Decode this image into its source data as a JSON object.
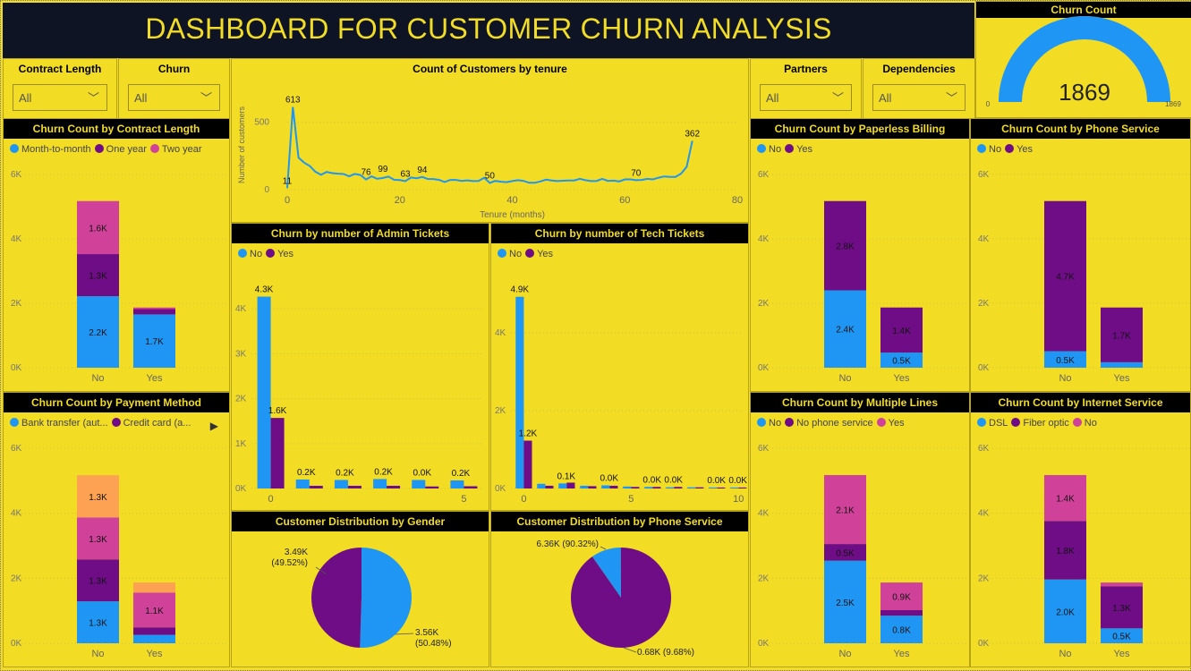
{
  "header": {
    "title": "DASHBOARD FOR CUSTOMER CHURN ANALYSIS"
  },
  "colors": {
    "bg": "#f2dc24",
    "blue": "#1f96f3",
    "purple": "#6e0d86",
    "pink": "#d04299",
    "orange": "#fca252"
  },
  "slicers": {
    "contract": {
      "title": "Contract Length",
      "value": "All"
    },
    "churn": {
      "title": "Churn",
      "value": "All"
    },
    "partners": {
      "title": "Partners",
      "value": "All"
    },
    "dependencies": {
      "title": "Dependencies",
      "value": "All"
    }
  },
  "gauge": {
    "title": "Churn Count",
    "value": "1869",
    "min": "0",
    "max": "1869",
    "fraction": 1.0
  },
  "tenure_chart": {
    "title": "Count of Customers by tenure",
    "chart_data": {
      "type": "line",
      "xlabel": "Tenure (months)",
      "ylabel": "Number of customers",
      "xticks": [
        "0",
        "20",
        "40",
        "60",
        "80"
      ],
      "yticks": [
        "0",
        "500"
      ],
      "xlim": [
        0,
        80
      ],
      "ylim": [
        0,
        650
      ],
      "x": [
        0,
        1,
        2,
        3,
        4,
        5,
        6,
        7,
        8,
        9,
        10,
        11,
        12,
        13,
        14,
        15,
        16,
        17,
        18,
        19,
        20,
        21,
        22,
        23,
        24,
        25,
        26,
        27,
        28,
        29,
        30,
        31,
        32,
        33,
        34,
        35,
        36,
        37,
        38,
        39,
        40,
        41,
        42,
        43,
        44,
        45,
        46,
        47,
        48,
        49,
        50,
        51,
        52,
        53,
        54,
        55,
        56,
        57,
        58,
        59,
        60,
        61,
        62,
        63,
        64,
        65,
        65,
        66,
        67,
        68,
        69,
        70,
        71,
        72
      ],
      "y": [
        11,
        613,
        238,
        200,
        176,
        133,
        110,
        131,
        123,
        119,
        116,
        99,
        117,
        109,
        76,
        99,
        80,
        87,
        97,
        73,
        71,
        63,
        90,
        85,
        94,
        79,
        79,
        72,
        57,
        72,
        72,
        65,
        69,
        64,
        65,
        88,
        50,
        65,
        59,
        56,
        64,
        70,
        65,
        51,
        51,
        61,
        74,
        68,
        64,
        66,
        68,
        68,
        80,
        70,
        64,
        65,
        80,
        65,
        67,
        61,
        76,
        76,
        70,
        72,
        80,
        76,
        76,
        89,
        98,
        95,
        95,
        119,
        170,
        362
      ],
      "labels": [
        {
          "x": 0,
          "y": 11,
          "text": "11"
        },
        {
          "x": 1,
          "y": 613,
          "text": "613"
        },
        {
          "x": 14,
          "y": 76,
          "text": "76"
        },
        {
          "x": 17,
          "y": 99,
          "text": "99"
        },
        {
          "x": 21,
          "y": 63,
          "text": "63"
        },
        {
          "x": 24,
          "y": 94,
          "text": "94"
        },
        {
          "x": 36,
          "y": 50,
          "text": "50"
        },
        {
          "x": 62,
          "y": 70,
          "text": "70"
        },
        {
          "x": 72,
          "y": 362,
          "text": "362"
        }
      ]
    }
  },
  "charts": {
    "contract": {
      "title": "Churn Count by Contract Length",
      "legend": [
        {
          "label": "Month-to-month",
          "color": "#1f96f3"
        },
        {
          "label": "One year",
          "color": "#6e0d86"
        },
        {
          "label": "Two year",
          "color": "#d04299"
        }
      ],
      "chart_data": {
        "type": "bar",
        "stacked": true,
        "categories": [
          "No",
          "Yes"
        ],
        "yticks": [
          "0K",
          "2K",
          "4K",
          "6K"
        ],
        "ylim": [
          0,
          6000
        ],
        "series": [
          {
            "name": "Month-to-month",
            "color": "#1f96f3",
            "values": [
              2220,
              1655
            ],
            "labels": [
              "2.2K",
              "1.7K"
            ]
          },
          {
            "name": "One year",
            "color": "#6e0d86",
            "values": [
              1307,
              166
            ],
            "labels": [
              "1.3K",
              ""
            ]
          },
          {
            "name": "Two year",
            "color": "#d04299",
            "values": [
              1647,
              48
            ],
            "labels": [
              "1.6K",
              ""
            ]
          }
        ]
      }
    },
    "payment": {
      "title": "Churn Count by Payment Method",
      "legend": [
        {
          "label": "Bank transfer (aut...",
          "color": "#1f96f3"
        },
        {
          "label": "Credit card (a...",
          "color": "#6e0d86"
        }
      ],
      "chart_data": {
        "type": "bar",
        "stacked": true,
        "categories": [
          "No",
          "Yes"
        ],
        "yticks": [
          "0K",
          "2K",
          "4K",
          "6K"
        ],
        "ylim": [
          0,
          6000
        ],
        "series": [
          {
            "name": "Bank transfer (aut...",
            "color": "#1f96f3",
            "values": [
              1290,
              260
            ],
            "labels": [
              "1.3K",
              ""
            ]
          },
          {
            "name": "Credit card (a...",
            "color": "#6e0d86",
            "values": [
              1290,
              230
            ],
            "labels": [
              "1.3K",
              ""
            ]
          },
          {
            "color": "#d04299",
            "values": [
              1290,
              1070
            ],
            "labels": [
              "1.3K",
              "1.1K"
            ]
          },
          {
            "color": "#fca252",
            "values": [
              1300,
              310
            ],
            "labels": [
              "1.3K",
              ""
            ]
          }
        ]
      }
    },
    "admin": {
      "title": "Churn by number of Admin Tickets",
      "legend": [
        {
          "label": "No",
          "color": "#1f96f3"
        },
        {
          "label": "Yes",
          "color": "#6e0d86"
        }
      ],
      "chart_data": {
        "type": "bar",
        "grouped": true,
        "xmin": -0.5,
        "xmax": 5.5,
        "xticks": [
          {
            "v": 0,
            "t": "0"
          },
          {
            "v": 5,
            "t": "5"
          }
        ],
        "yticks": [
          "0K",
          "1K",
          "2K",
          "3K",
          "4K"
        ],
        "ylim": [
          0,
          4500
        ],
        "data": [
          {
            "x": 0,
            "no": 4270,
            "yes": 1570,
            "noLabel": "4.3K",
            "yesLabel": "1.6K"
          },
          {
            "x": 1,
            "no": 200,
            "yes": 60,
            "noLabel": "0.2K",
            "yesLabel": ""
          },
          {
            "x": 2,
            "no": 190,
            "yes": 60,
            "noLabel": "0.2K",
            "yesLabel": ""
          },
          {
            "x": 3,
            "no": 210,
            "yes": 60,
            "noLabel": "0.2K",
            "yesLabel": ""
          },
          {
            "x": 4,
            "no": 190,
            "yes": 45,
            "noLabel": "0.0K",
            "yesLabel": ""
          },
          {
            "x": 5,
            "no": 180,
            "yes": 50,
            "noLabel": "0.2K",
            "yesLabel": ""
          }
        ]
      }
    },
    "tech": {
      "title": "Churn by number of Tech Tickets",
      "legend": [
        {
          "label": "No",
          "color": "#1f96f3"
        },
        {
          "label": "Yes",
          "color": "#6e0d86"
        }
      ],
      "chart_data": {
        "type": "bar",
        "grouped": true,
        "xmin": -0.6,
        "xmax": 10.2,
        "xticks": [
          {
            "v": 0,
            "t": "0"
          },
          {
            "v": 5,
            "t": "5"
          },
          {
            "v": 10,
            "t": "10"
          }
        ],
        "yticks": [
          "0K",
          "2K",
          "4K"
        ],
        "ylim": [
          0,
          5200
        ],
        "data": [
          {
            "x": 0,
            "no": 4930,
            "yes": 1230,
            "noLabel": "4.9K",
            "yesLabel": "1.2K"
          },
          {
            "x": 1,
            "no": 120,
            "yes": 70,
            "noLabel": "",
            "yesLabel": ""
          },
          {
            "x": 2,
            "no": 130,
            "yes": 150,
            "noLabel": "0.1K",
            "yesLabel": ""
          },
          {
            "x": 3,
            "no": 70,
            "yes": 60,
            "noLabel": "",
            "yesLabel": ""
          },
          {
            "x": 4,
            "no": 80,
            "yes": 70,
            "noLabel": "0.0K",
            "yesLabel": ""
          },
          {
            "x": 5,
            "no": 50,
            "yes": 40,
            "noLabel": "",
            "yesLabel": ""
          },
          {
            "x": 6,
            "no": 40,
            "yes": 40,
            "noLabel": "0.0K",
            "yesLabel": ""
          },
          {
            "x": 7,
            "no": 30,
            "yes": 40,
            "noLabel": "0.0K",
            "yesLabel": ""
          },
          {
            "x": 8,
            "no": 30,
            "yes": 30,
            "noLabel": "",
            "yesLabel": ""
          },
          {
            "x": 9,
            "no": 25,
            "yes": 25,
            "noLabel": "0.0K",
            "yesLabel": ""
          },
          {
            "x": 10,
            "no": 25,
            "yes": 25,
            "noLabel": "0.0K",
            "yesLabel": ""
          }
        ]
      }
    },
    "paperless": {
      "title": "Churn Count by Paperless Billing",
      "legend": [
        {
          "label": "No",
          "color": "#1f96f3"
        },
        {
          "label": "Yes",
          "color": "#6e0d86"
        }
      ],
      "chart_data": {
        "type": "bar",
        "stacked": true,
        "categories": [
          "No",
          "Yes"
        ],
        "yticks": [
          "0K",
          "2K",
          "4K",
          "6K"
        ],
        "ylim": [
          0,
          6000
        ],
        "series": [
          {
            "name": "No",
            "color": "#1f96f3",
            "values": [
              2403,
              469
            ],
            "labels": [
              "2.4K",
              "0.5K"
            ]
          },
          {
            "name": "Yes",
            "color": "#6e0d86",
            "values": [
              2771,
              1400
            ],
            "labels": [
              "2.8K",
              "1.4K"
            ]
          }
        ]
      }
    },
    "phone": {
      "title": "Churn Count by Phone Service",
      "legend": [
        {
          "label": "No",
          "color": "#1f96f3"
        },
        {
          "label": "Yes",
          "color": "#6e0d86"
        }
      ],
      "chart_data": {
        "type": "bar",
        "stacked": true,
        "categories": [
          "No",
          "Yes"
        ],
        "yticks": [
          "0K",
          "2K",
          "4K",
          "6K"
        ],
        "ylim": [
          0,
          6000
        ],
        "series": [
          {
            "name": "No",
            "color": "#1f96f3",
            "values": [
              512,
              170
            ],
            "labels": [
              "0.5K",
              ""
            ]
          },
          {
            "name": "Yes",
            "color": "#6e0d86",
            "values": [
              4662,
              1699
            ],
            "labels": [
              "4.7K",
              "1.7K"
            ]
          }
        ]
      }
    },
    "multiple": {
      "title": "Churn Count by Multiple Lines",
      "legend": [
        {
          "label": "No",
          "color": "#1f96f3"
        },
        {
          "label": "No phone service",
          "color": "#6e0d86"
        },
        {
          "label": "Yes",
          "color": "#d04299"
        }
      ],
      "chart_data": {
        "type": "bar",
        "stacked": true,
        "categories": [
          "No",
          "Yes"
        ],
        "yticks": [
          "0K",
          "2K",
          "4K",
          "6K"
        ],
        "ylim": [
          0,
          6000
        ],
        "series": [
          {
            "name": "No",
            "color": "#1f96f3",
            "values": [
              2541,
              849
            ],
            "labels": [
              "2.5K",
              "0.8K"
            ]
          },
          {
            "name": "No phone service",
            "color": "#6e0d86",
            "values": [
              512,
              170
            ],
            "labels": [
              "0.5K",
              ""
            ]
          },
          {
            "name": "Yes",
            "color": "#d04299",
            "values": [
              2121,
              850
            ],
            "labels": [
              "2.1K",
              "0.9K"
            ]
          }
        ]
      }
    },
    "internet": {
      "title": "Churn Count by Internet Service",
      "legend": [
        {
          "label": "DSL",
          "color": "#1f96f3"
        },
        {
          "label": "Fiber optic",
          "color": "#6e0d86"
        },
        {
          "label": "No",
          "color": "#d04299"
        }
      ],
      "chart_data": {
        "type": "bar",
        "stacked": true,
        "categories": [
          "No",
          "Yes"
        ],
        "yticks": [
          "0K",
          "2K",
          "4K",
          "6K"
        ],
        "ylim": [
          0,
          6000
        ],
        "series": [
          {
            "name": "DSL",
            "color": "#1f96f3",
            "values": [
              1962,
              459
            ],
            "labels": [
              "2.0K",
              "0.5K"
            ]
          },
          {
            "name": "Fiber optic",
            "color": "#6e0d86",
            "values": [
              1799,
              1297
            ],
            "labels": [
              "1.8K",
              "1.3K"
            ]
          },
          {
            "name": "No",
            "color": "#d04299",
            "values": [
              1413,
              113
            ],
            "labels": [
              "1.4K",
              ""
            ]
          }
        ]
      }
    },
    "gender": {
      "title": "Customer Distribution by Gender",
      "chart_data": {
        "type": "pie",
        "slices": [
          {
            "value": 3560,
            "pct": 50.48,
            "label": "3.56K",
            "pct_label": "(50.48%)",
            "color": "#1f96f3"
          },
          {
            "value": 3490,
            "pct": 49.52,
            "label": "3.49K",
            "pct_label": "(49.52%)",
            "color": "#6e0d86"
          }
        ]
      }
    },
    "phone_dist": {
      "title": "Customer Distribution by Phone Service",
      "chart_data": {
        "type": "pie",
        "slices": [
          {
            "value": 680,
            "pct": 9.68,
            "label": "0.68K (9.68%)",
            "color": "#1f96f3"
          },
          {
            "value": 6360,
            "pct": 90.32,
            "label": "6.36K (90.32%)",
            "color": "#6e0d86"
          }
        ]
      }
    }
  }
}
